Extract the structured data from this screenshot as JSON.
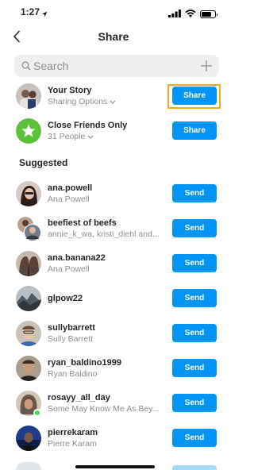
{
  "status_bar": {
    "time": "1:27"
  },
  "nav": {
    "title": "Share"
  },
  "search": {
    "placeholder": "Search"
  },
  "story_rows": [
    {
      "name": "Your Story",
      "subtitle": "Sharing Options",
      "button": "Share"
    },
    {
      "name": "Close Friends Only",
      "subtitle": "31 People",
      "button": "Share"
    }
  ],
  "suggested": {
    "title": "Suggested",
    "button_label": "Send",
    "items": [
      {
        "username": "ana.powell",
        "subtitle": "Ana Powell"
      },
      {
        "username": "beefiest of beefs",
        "subtitle": "annie_k_wa, kristi_diehl and..."
      },
      {
        "username": "ana.banana22",
        "subtitle": "Ana Powell"
      },
      {
        "username": "glpow22",
        "subtitle": ""
      },
      {
        "username": "sullybarrett",
        "subtitle": "Sully Barrett"
      },
      {
        "username": "ryan_baldino1999",
        "subtitle": "Ryan Baldino"
      },
      {
        "username": "rosayy_all_day",
        "subtitle": "Some May Know Me As Bey..."
      },
      {
        "username": "pierrekaram",
        "subtitle": "Pierre Karam"
      }
    ]
  },
  "colors": {
    "accent": "#0095f6",
    "highlight": "#f5a623",
    "close_friends": "#5bc13a"
  }
}
